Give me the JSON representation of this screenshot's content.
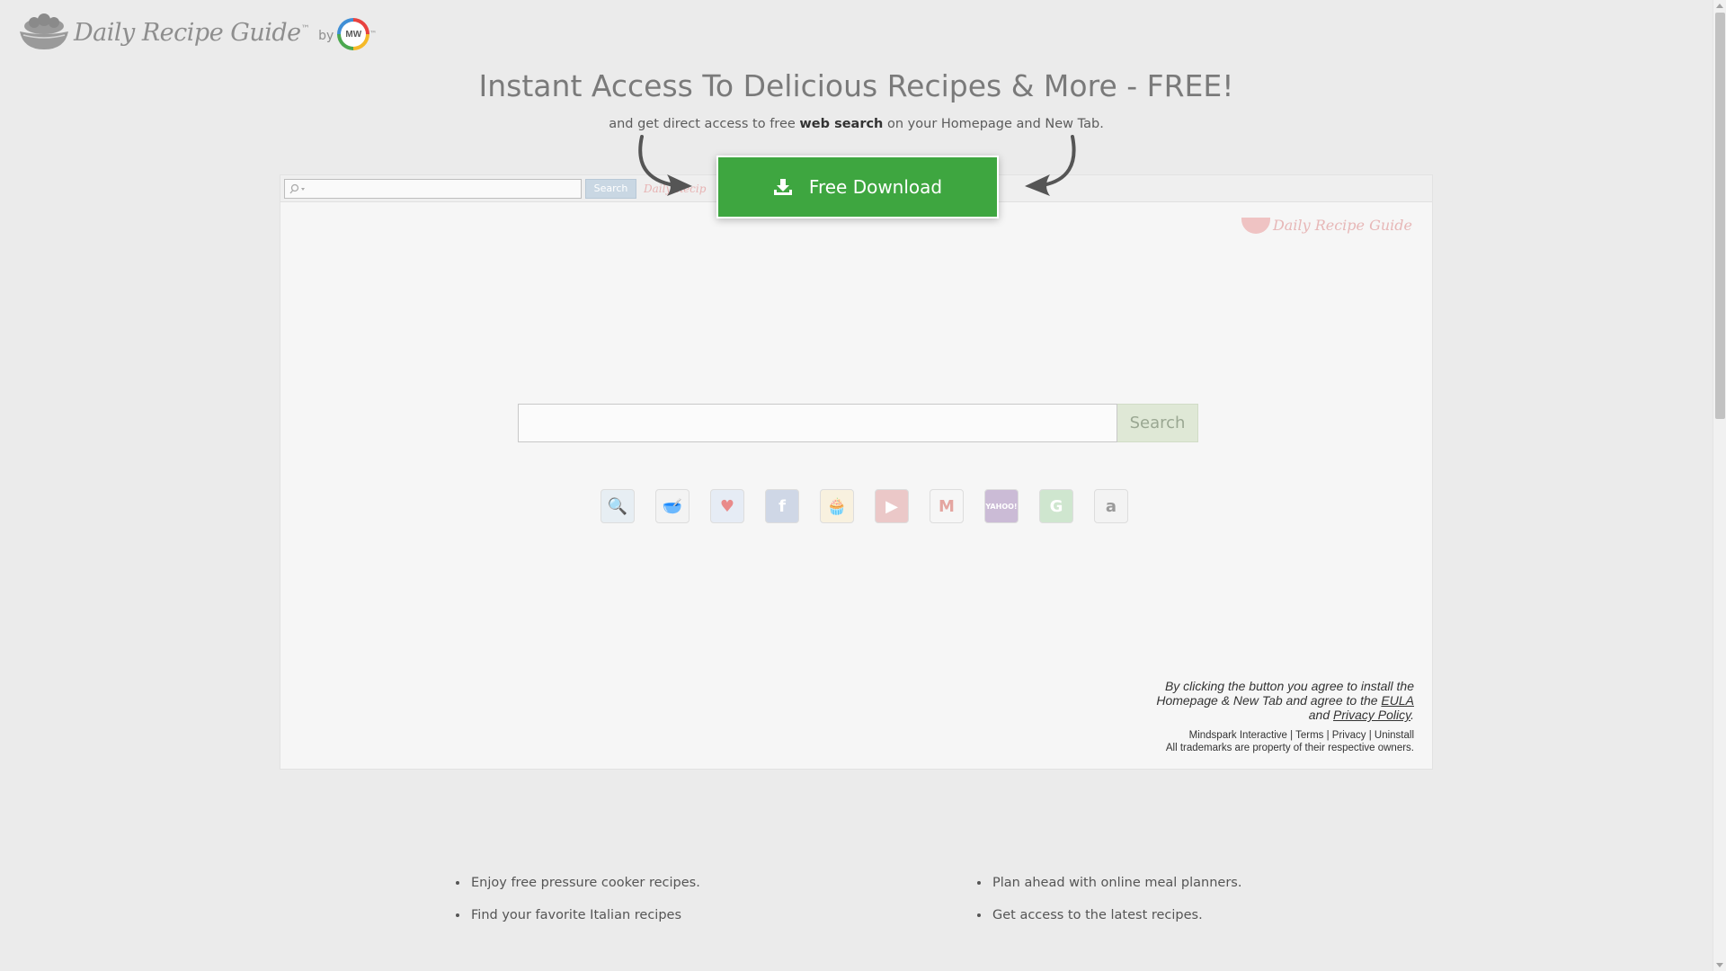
{
  "brand": {
    "name": "Daily Recipe Guide",
    "tm": "™",
    "by": "by",
    "mw_badge": "MW",
    "mw_tm": "™"
  },
  "hero": {
    "headline": "Instant Access To Delicious Recipes & More - FREE!",
    "subline_pre": "and get direct access to free ",
    "subline_bold": "web search",
    "subline_post": " on your Homepage and New Tab."
  },
  "download": {
    "label": "Free Download",
    "icon": "download-icon",
    "color": "#3ea640"
  },
  "preview": {
    "toolbar_search_button": "Search",
    "toolbar_logo_text": "Daily Recip",
    "logo_text": "Daily Recipe Guide",
    "main_search_button": "Search",
    "tiles": [
      {
        "name": "search-tile",
        "glyph": "🔍",
        "bg": "#e7eef3",
        "color": "#9bb3c6"
      },
      {
        "name": "recipe-bowl-tile",
        "glyph": "🥣",
        "bg": "#f3f3f3",
        "color": "#b2c6d6"
      },
      {
        "name": "heart-tile",
        "glyph": "♥",
        "bg": "#e6ecf5",
        "color": "#e98a8a"
      },
      {
        "name": "facebook-tile",
        "glyph": "f",
        "bg": "#cfd7e6",
        "color": "#ffffff"
      },
      {
        "name": "cupcake-tile",
        "glyph": "🧁",
        "bg": "#f8f1df",
        "color": "#e6b4b4"
      },
      {
        "name": "youtube-tile",
        "glyph": "▶",
        "bg": "#ebc8c8",
        "color": "#ffffff"
      },
      {
        "name": "gmail-tile",
        "glyph": "M",
        "bg": "#f6f6f6",
        "color": "#e4a5a0"
      },
      {
        "name": "yahoo-tile",
        "glyph": "YAHOO!",
        "bg": "#cbbbd6",
        "color": "#ffffff"
      },
      {
        "name": "grammarly-tile",
        "glyph": "G",
        "bg": "#cfe6cf",
        "color": "#ffffff"
      },
      {
        "name": "amazon-tile",
        "glyph": "a",
        "bg": "#f3f3f3",
        "color": "#9a9a9a"
      }
    ]
  },
  "legal": {
    "line1": "By clicking the button you agree to install the",
    "line2_pre": "Homepage & New Tab and agree to the ",
    "eula": "EULA",
    "line3_pre": "and ",
    "privacy_policy": "Privacy Policy",
    "line3_post": ".",
    "footer_links": [
      "Mindspark Interactive",
      "Terms",
      "Privacy",
      "Uninstall"
    ],
    "trademark": "All trademarks are property of their respective owners."
  },
  "features": {
    "left": [
      "Enjoy free pressure cooker recipes.",
      "Find your favorite Italian recipes"
    ],
    "right": [
      "Plan ahead with online meal planners.",
      "Get access to the latest recipes."
    ]
  }
}
